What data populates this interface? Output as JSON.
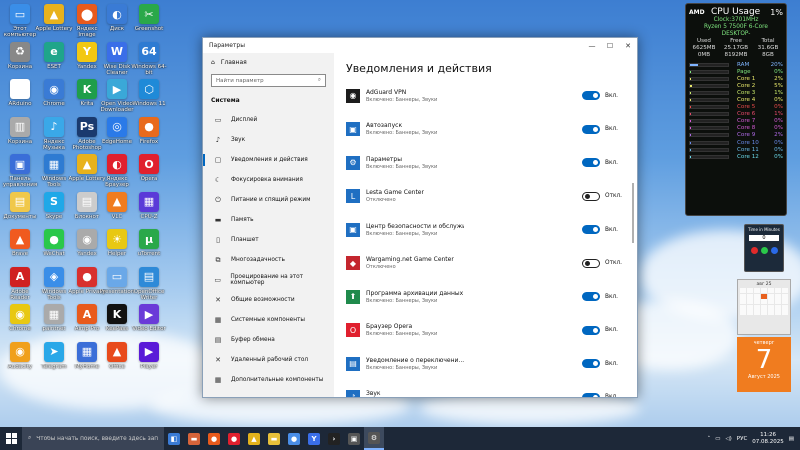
{
  "window": {
    "title": "Параметры",
    "min": "—",
    "max": "☐",
    "close": "✕",
    "home_label": "Главная",
    "search_placeholder": "Найти параметр",
    "section": "Система",
    "nav": [
      {
        "label": "Дисплей",
        "icon": "▭"
      },
      {
        "label": "Звук",
        "icon": "♪"
      },
      {
        "label": "Уведомления и действия",
        "icon": "▢",
        "active": true
      },
      {
        "label": "Фокусировка внимания",
        "icon": "☾"
      },
      {
        "label": "Питание и спящий режим",
        "icon": "⏻"
      },
      {
        "label": "Память",
        "icon": "▬"
      },
      {
        "label": "Планшет",
        "icon": "▯"
      },
      {
        "label": "Многозадачность",
        "icon": "⧉"
      },
      {
        "label": "Проецирование на этот компьютер",
        "icon": "▭"
      },
      {
        "label": "Общие возможности",
        "icon": "✕"
      },
      {
        "label": "Системные компоненты",
        "icon": "▦"
      },
      {
        "label": "Буфер обмена",
        "icon": "▤"
      },
      {
        "label": "Удаленный рабочий стол",
        "icon": "✕"
      },
      {
        "label": "Дополнительные компоненты",
        "icon": "▦"
      }
    ],
    "page_title": "Уведомления и действия",
    "apps": [
      {
        "name": "AdGuard VPN",
        "sub": "Включено: Баннеры, Звуки",
        "on": true,
        "state": "Вкл.",
        "icon": "◉",
        "color": "#1c1c1c"
      },
      {
        "name": "Автозапуск",
        "sub": "Включено: Баннеры, Звуки",
        "on": true,
        "state": "Вкл.",
        "icon": "▣",
        "color": "#1f6fc2"
      },
      {
        "name": "Параметры",
        "sub": "Включено: Баннеры, Звуки",
        "on": true,
        "state": "Вкл.",
        "icon": "⚙",
        "color": "#1f6fc2"
      },
      {
        "name": "Lesta Game Center",
        "sub": "Отключено",
        "on": false,
        "state": "Откл.",
        "icon": "L",
        "color": "#1f6fc2"
      },
      {
        "name": "Центр безопасности и обслужи...",
        "sub": "Включено: Баннеры, Звуки",
        "on": true,
        "state": "Вкл.",
        "icon": "▣",
        "color": "#1f6fc2"
      },
      {
        "name": "Wargaming.net Game Center",
        "sub": "Отключено",
        "on": false,
        "state": "Откл.",
        "icon": "◆",
        "color": "#c4262e"
      },
      {
        "name": "Программа архивации данных",
        "sub": "Включено: Баннеры, Звуки",
        "on": true,
        "state": "Вкл.",
        "icon": "⬆",
        "color": "#1f8a4c"
      },
      {
        "name": "Браузер Opera",
        "sub": "Включено: Баннеры, Звуки",
        "on": true,
        "state": "Вкл.",
        "icon": "O",
        "color": "#e0202e"
      },
      {
        "name": "Уведомление о переключени...",
        "sub": "Включено: Баннеры, Звуки",
        "on": true,
        "state": "Вкл.",
        "icon": "▤",
        "color": "#1f6fc2"
      },
      {
        "name": "Звук",
        "sub": "Включено: Баннеры, Звуки",
        "on": true,
        "state": "Вкл.",
        "icon": "♪",
        "color": "#1f6fc2"
      }
    ]
  },
  "cpu_widget": {
    "brand": "AMD",
    "title": "CPU Usage",
    "total": "1%",
    "clock": "Clock:3701MHz",
    "model": "Ryzen 5 7500F 6-Core",
    "host": "DESKTOP-",
    "mem_headers": [
      "Used",
      "Free",
      "Total"
    ],
    "ram_row": [
      "6625MB",
      "25.17GB",
      "31.6GB"
    ],
    "page_row": [
      "0MB",
      "8192MB",
      "8GB"
    ],
    "rows": [
      {
        "name": "RAM",
        "val": "20%",
        "color": "#7fb4ff"
      },
      {
        "name": "Page",
        "val": "0%",
        "color": "#7fe67f"
      },
      {
        "name": "Core 1",
        "val": "2%",
        "color": "#e8e86a"
      },
      {
        "name": "Core 2",
        "val": "5%",
        "color": "#e8e86a"
      },
      {
        "name": "Core 3",
        "val": "1%",
        "color": "#c7e86a"
      },
      {
        "name": "Core 4",
        "val": "0%",
        "color": "#e8e86a"
      },
      {
        "name": "Core 5",
        "val": "0%",
        "color": "#e84a4a"
      },
      {
        "name": "Core 6",
        "val": "1%",
        "color": "#e84a6a"
      },
      {
        "name": "Core 7",
        "val": "0%",
        "color": "#d45ad4"
      },
      {
        "name": "Core 8",
        "val": "0%",
        "color": "#d45ad4"
      },
      {
        "name": "Core 9",
        "val": "2%",
        "color": "#b06ae8"
      },
      {
        "name": "Core 10",
        "val": "0%",
        "color": "#6a8ae8"
      },
      {
        "name": "Core 11",
        "val": "0%",
        "color": "#6ab8e8"
      },
      {
        "name": "Core 12",
        "val": "0%",
        "color": "#6ad8e8"
      }
    ]
  },
  "timer_widget": {
    "title": "Time in Minutes",
    "value": "0"
  },
  "calendar": {
    "month": "авг 25",
    "weekday": "четверг",
    "day": "7",
    "month_year": "Август 2025"
  },
  "taskbar": {
    "search_placeholder": "Чтобы начать поиск, введите здесь запрос",
    "lang": "РУС",
    "time": "11:26",
    "date": "07.08.2025",
    "apps": [
      {
        "glyph": "◧",
        "color": "#3a7bd5"
      },
      {
        "glyph": "▬",
        "color": "#d6643a"
      },
      {
        "glyph": "●",
        "color": "#e85a1c"
      },
      {
        "glyph": "●",
        "color": "#e0202e"
      },
      {
        "glyph": "▲",
        "color": "#e3b21c"
      },
      {
        "glyph": "▬",
        "color": "#e8c13a"
      },
      {
        "glyph": "●",
        "color": "#4a8ee8"
      },
      {
        "glyph": "Y",
        "color": "#3a6ee8"
      },
      {
        "glyph": "›",
        "color": "#222"
      },
      {
        "glyph": "▣",
        "color": "#555"
      },
      {
        "glyph": "⚙",
        "color": "#555",
        "active": true
      }
    ]
  },
  "desktop_icons": [
    {
      "label": "Этот компьютер",
      "glyph": "▭",
      "color": "#3a8ee8"
    },
    {
      "label": "Apple Lottery",
      "glyph": "▲",
      "color": "#e8b21c"
    },
    {
      "label": "Яндекс Image Backup",
      "glyph": "⬤",
      "color": "#e85a1c"
    },
    {
      "label": "Диск",
      "glyph": "◐",
      "color": "#3a7bd5"
    },
    {
      "label": "Greenshot",
      "glyph": "✂",
      "color": "#2aa84a"
    },
    {
      "label": "Корзина",
      "glyph": "♻",
      "color": "#888"
    },
    {
      "label": "ESET",
      "glyph": "e",
      "color": "#1fa58a"
    },
    {
      "label": "Yandex",
      "glyph": "Y",
      "color": "#f2c812"
    },
    {
      "label": "Wise Disk Cleaner",
      "glyph": "W",
      "color": "#3a6ee8"
    },
    {
      "label": "Windows 64-bit",
      "glyph": "64",
      "color": "#2e7bd2"
    },
    {
      "label": "ARduino",
      "glyph": "▤",
      "color": "#fff"
    },
    {
      "label": "Chrome",
      "glyph": "◉",
      "color": "#3a7bd5"
    },
    {
      "label": "Krita",
      "glyph": "K",
      "color": "#1f9e4a"
    },
    {
      "label": "Open Video Downloader",
      "glyph": "▶",
      "color": "#3aa8d8"
    },
    {
      "label": "Windows 11",
      "glyph": "⬡",
      "color": "#1f8ad8"
    },
    {
      "label": "Корзина",
      "glyph": "▥",
      "color": "#aaa"
    },
    {
      "label": "Яндекс Музыка",
      "glyph": "♪",
      "color": "#3aa8e8"
    },
    {
      "label": "Adobe Photoshop",
      "glyph": "Ps",
      "color": "#1a3a6e"
    },
    {
      "label": "EdgeHome",
      "glyph": "◎",
      "color": "#2a7ae8"
    },
    {
      "label": "Firefox",
      "glyph": "●",
      "color": "#e86a1c"
    },
    {
      "label": "Панель управления",
      "glyph": "▣",
      "color": "#3a6ed8"
    },
    {
      "label": "Windows Tools",
      "glyph": "▦",
      "color": "#2e7bd2"
    },
    {
      "label": "Apple Lottery",
      "glyph": "▲",
      "color": "#e8b21c"
    },
    {
      "label": "Яндекс Браузер",
      "glyph": "◐",
      "color": "#e0202e"
    },
    {
      "label": "Opera",
      "glyph": "O",
      "color": "#e0202e"
    },
    {
      "label": "Документы",
      "glyph": "▤",
      "color": "#f0c84a"
    },
    {
      "label": "Skype",
      "glyph": "S",
      "color": "#1fa8e8"
    },
    {
      "label": "Блокнот",
      "glyph": "▤",
      "color": "#ccc"
    },
    {
      "label": "VLC",
      "glyph": "▲",
      "color": "#f07c1f"
    },
    {
      "label": "CPU-Z",
      "glyph": "▦",
      "color": "#5a3ad8"
    },
    {
      "label": "Brave",
      "glyph": "▲",
      "color": "#f05a1f"
    },
    {
      "label": "WeChat",
      "glyph": "●",
      "color": "#2ac84a"
    },
    {
      "label": "Yandex",
      "glyph": "◉",
      "color": "#aaa"
    },
    {
      "label": "Helper",
      "glyph": "☀",
      "color": "#e8c812"
    },
    {
      "label": "uTorrent",
      "glyph": "µ",
      "color": "#2aa84a"
    },
    {
      "label": "Adobe Reader",
      "glyph": "A",
      "color": "#d02020"
    },
    {
      "label": "Windows Tools",
      "glyph": "◈",
      "color": "#3a8ee8"
    },
    {
      "label": "Apple Privacy",
      "glyph": "●",
      "color": "#d8302e"
    },
    {
      "label": "Presentation",
      "glyph": "▭",
      "color": "#6aa8e8"
    },
    {
      "label": "OpenOffice Writer",
      "glyph": "▤",
      "color": "#2e8ad8"
    },
    {
      "label": "Chrome",
      "glyph": "◉",
      "color": "#e8c812"
    },
    {
      "label": "paintnet",
      "glyph": "▦",
      "color": "#aaa"
    },
    {
      "label": "Aimp Pro",
      "glyph": "A",
      "color": "#e85a1c"
    },
    {
      "label": "KeePass",
      "glyph": "K",
      "color": "#111"
    },
    {
      "label": "Video Editor",
      "glyph": "▶",
      "color": "#6a3ad8"
    },
    {
      "label": "Audacity",
      "glyph": "◉",
      "color": "#f0a01c"
    },
    {
      "label": "Telegram",
      "glyph": "➤",
      "color": "#2aa8e8"
    },
    {
      "label": "MyHome",
      "glyph": "▦",
      "color": "#3a6ed8"
    },
    {
      "label": "Office",
      "glyph": "▲",
      "color": "#e84a1c"
    },
    {
      "label": "Player",
      "glyph": "▶",
      "color": "#5a1ad8"
    }
  ]
}
